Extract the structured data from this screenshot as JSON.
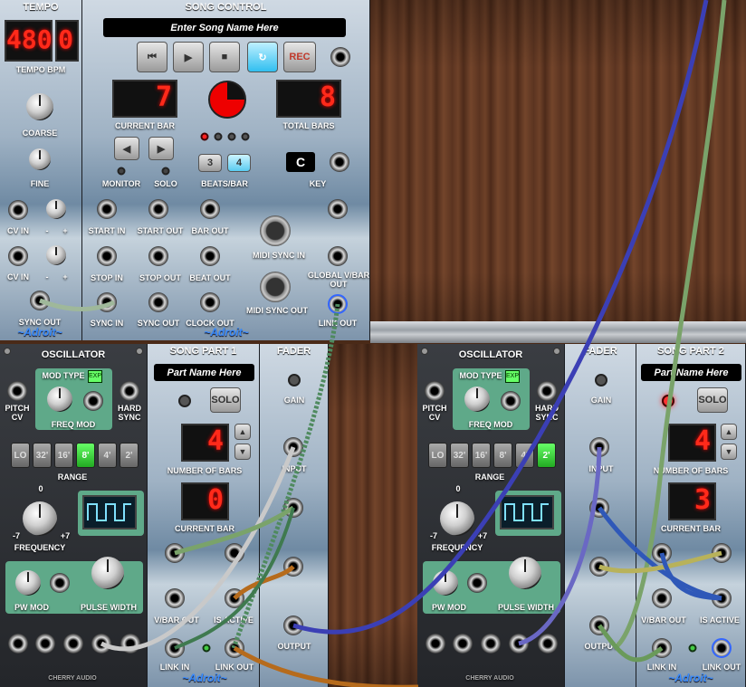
{
  "tempo": {
    "title": "TEMPO",
    "display": "480",
    "display_decimal": "0",
    "bpm_label": "TEMPO BPM",
    "coarse": "COARSE",
    "fine": "FINE",
    "cv_in": "CV IN",
    "minus": "-",
    "plus": "+",
    "sync_out": "SYNC OUT",
    "brand": "~Adroit~"
  },
  "song_control": {
    "title": "SONG CONTROL",
    "song_name_placeholder": "Enter Song Name Here",
    "rec": "REC",
    "current_bar_value": "7",
    "current_bar": "CURRENT BAR",
    "total_bars_value": "8",
    "total_bars": "TOTAL BARS",
    "monitor": "MONITOR",
    "solo": "SOLO",
    "beats_3": "3",
    "beats_4": "4",
    "beats_per_bar": "BEATS/BAR",
    "key_value": "C",
    "key": "KEY",
    "start_in": "START IN",
    "start_out": "START OUT",
    "bar_out": "BAR OUT",
    "midi_sync_in": "MIDI SYNC IN",
    "stop_in": "STOP IN",
    "stop_out": "STOP OUT",
    "beat_out": "BEAT OUT",
    "global_vbar_out": "GLOBAL V/BAR OUT",
    "midi_sync_out": "MIDI SYNC OUT",
    "sync_in": "SYNC IN",
    "sync_out": "SYNC OUT",
    "clock_out": "CLOCK OUT",
    "link_out": "LINK OUT",
    "brand": "~Adroit~"
  },
  "osc1": {
    "title": "OSCILLATOR",
    "mod_type": "MOD TYPE",
    "exp": "EXP",
    "pitch_cv": "PITCH CV",
    "hard_sync": "HARD SYNC",
    "freq_mod": "FREQ MOD",
    "range_buttons": [
      "LO",
      "32'",
      "16'",
      "8'",
      "4'",
      "2'"
    ],
    "range": "RANGE",
    "zero": "0",
    "minus7": "-7",
    "plus7": "+7",
    "frequency": "FREQUENCY",
    "pw_mod": "PW MOD",
    "pulse_width": "PULSE WIDTH",
    "brand": "CHERRY AUDIO"
  },
  "part1": {
    "title": "SONG PART 1",
    "name": "Part Name Here",
    "solo": "SOLO",
    "num_bars_value": "4",
    "number_of_bars": "NUMBER OF BARS",
    "current_bar_value": "0",
    "current_bar": "CURRENT BAR",
    "vbar_out": "V/BAR OUT",
    "is_active": "IS ACTIVE",
    "link_in": "LINK IN",
    "link_out": "LINK OUT",
    "brand": "~Adroit~"
  },
  "fader1": {
    "title": "FADER",
    "gain": "GAIN",
    "input": "INPUT",
    "output": "OUTPUT"
  },
  "osc2": {
    "title": "OSCILLATOR",
    "mod_type": "MOD TYPE",
    "exp": "EXP",
    "pitch_cv": "PITCH CV",
    "hard_sync": "HARD SYNC",
    "freq_mod": "FREQ MOD",
    "range_buttons": [
      "LO",
      "32'",
      "16'",
      "8'",
      "4'",
      "2'"
    ],
    "range": "RANGE",
    "zero": "0",
    "minus7": "-7",
    "plus7": "+7",
    "frequency": "FREQUENCY",
    "pw_mod": "PW MOD",
    "pulse_width": "PULSE WIDTH",
    "brand": "CHERRY AUDIO"
  },
  "fader2": {
    "title": "FADER",
    "gain": "GAIN",
    "input": "INPUT",
    "output": "OUTPUT"
  },
  "part2": {
    "title": "SONG PART 2",
    "name": "Part Name Here",
    "solo": "SOLO",
    "num_bars_value": "4",
    "number_of_bars": "NUMBER OF BARS",
    "current_bar_value": "3",
    "current_bar": "CURRENT BAR",
    "vbar_out": "V/BAR OUT",
    "is_active": "IS ACTIVE",
    "link_in": "LINK IN",
    "link_out": "LINK OUT",
    "brand": "~Adroit~"
  },
  "colors": {
    "accent_blue": "#3a8cff",
    "led_red": "#ff2a1a",
    "green_panel": "#5fa989",
    "cable_green": "#7aa36a",
    "cable_blue": "#3b3fb5",
    "cable_orange": "#b66b1c"
  }
}
